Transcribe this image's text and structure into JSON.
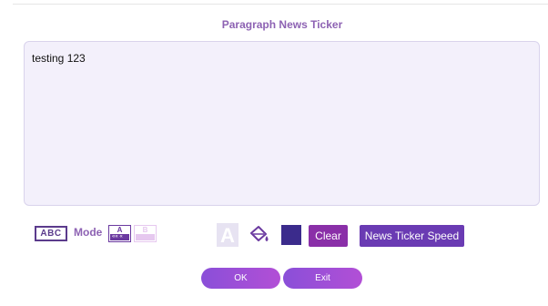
{
  "dialog": {
    "title": "Paragraph News Ticker"
  },
  "editor": {
    "text": "testing 123"
  },
  "toolbar": {
    "abc_label": "ABC",
    "mode_label": "Mode",
    "mode_a_letter": "A",
    "mode_a_arrows": "«« «",
    "mode_b_letter": "B",
    "font_color_letter": "A",
    "swatch_color": "#3b2b8c",
    "clear_label": "Clear",
    "speed_label": "News Ticker Speed"
  },
  "footer": {
    "ok_label": "OK",
    "exit_label": "Exit"
  }
}
